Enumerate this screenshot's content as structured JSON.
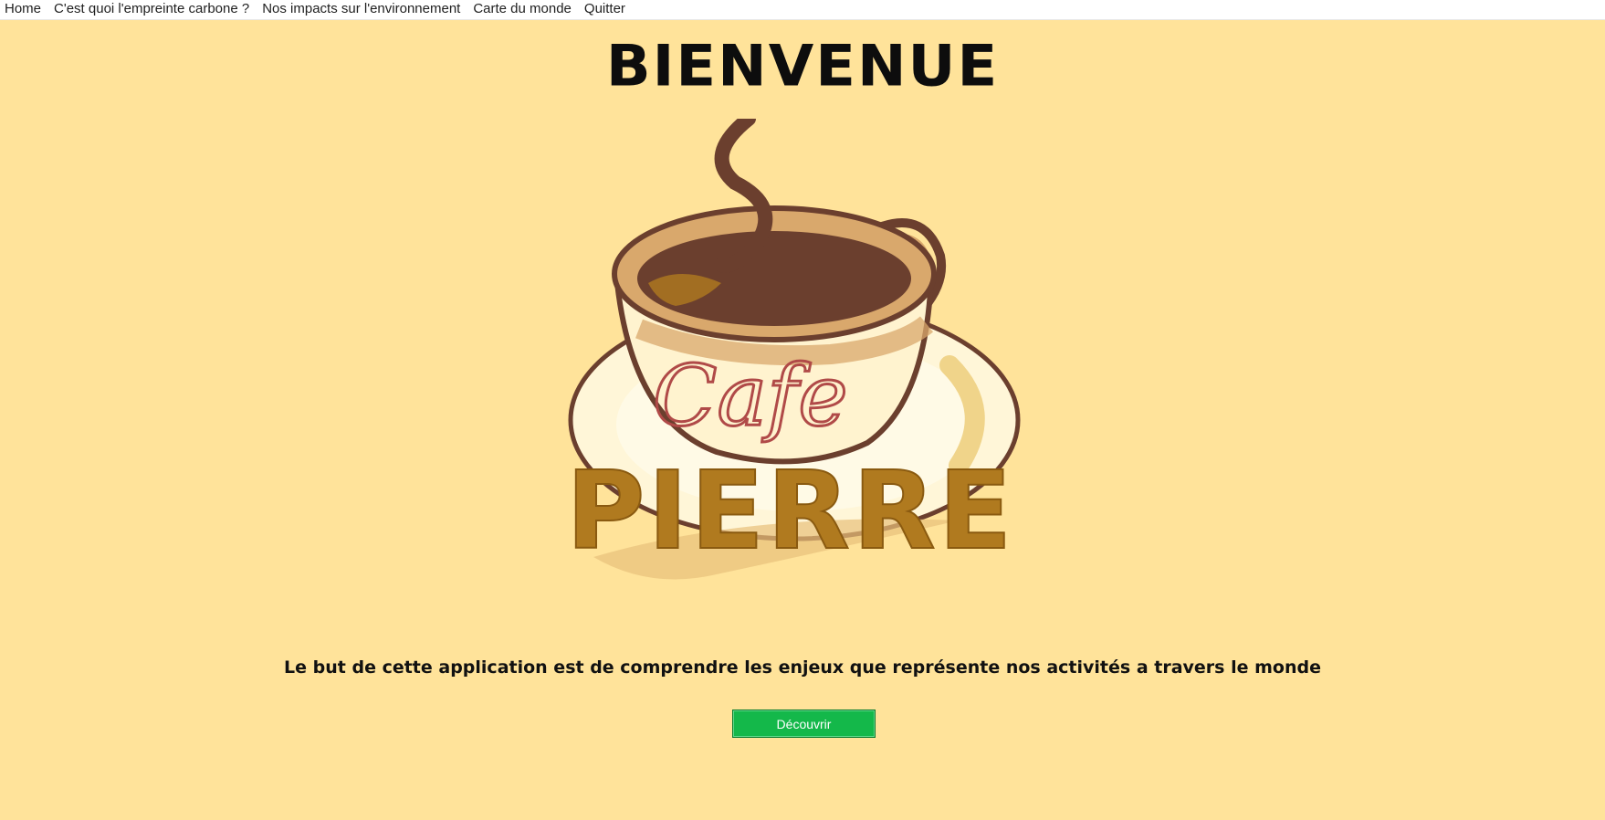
{
  "menu": {
    "items": [
      {
        "label": "Home"
      },
      {
        "label": "C'est quoi l'empreinte carbone ?"
      },
      {
        "label": "Nos impacts sur l'environnement"
      },
      {
        "label": "Carte du monde"
      },
      {
        "label": "Quitter"
      }
    ]
  },
  "header": {
    "title": "BIENVENUE"
  },
  "logo": {
    "script_text": "Cafe",
    "brand_text": "PIERRE",
    "colors": {
      "coffee": "#6B3F2E",
      "cup_rim": "#D9A86C",
      "cream": "#FFF6D8",
      "brand": "#B07A1F",
      "script": "#B04A48"
    }
  },
  "main": {
    "description": "Le but de cette application est de comprendre les enjeux que représente nos activités a travers le monde",
    "discover_label": "Découvrir"
  },
  "colors": {
    "background": "#FFE39A",
    "button": "#14B84A"
  }
}
